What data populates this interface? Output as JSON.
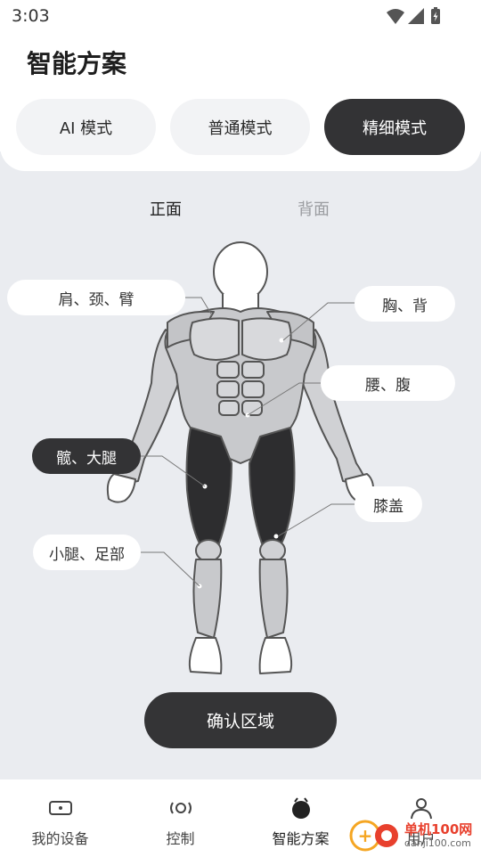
{
  "status_bar": {
    "time": "3:03"
  },
  "page": {
    "title": "智能方案"
  },
  "modes": [
    {
      "label": "AI 模式",
      "active": false
    },
    {
      "label": "普通模式",
      "active": false
    },
    {
      "label": "精细模式",
      "active": true
    }
  ],
  "view_tabs": {
    "front": "正面",
    "back": "背面",
    "selected": "front"
  },
  "regions": {
    "shoulder": "肩、颈、臂",
    "chest": "胸、背",
    "waist": "腰、腹",
    "hip": "髋、大腿",
    "knee": "膝盖",
    "calf": "小腿、足部",
    "selected": "hip"
  },
  "confirm_label": "确认区域",
  "nav": [
    {
      "label": "我的设备",
      "icon": "device-icon"
    },
    {
      "label": "控制",
      "icon": "control-icon"
    },
    {
      "label": "智能方案",
      "icon": "smart-plan-icon",
      "active": true
    },
    {
      "label": "用户",
      "icon": "user-icon"
    }
  ],
  "watermark": {
    "text": "单机100网",
    "url_text": "danji100.com"
  },
  "colors": {
    "dark": "#333335",
    "canvas": "#eaecf0",
    "muscle": "#c8c9cc",
    "selected_muscle": "#2d2d2f"
  }
}
